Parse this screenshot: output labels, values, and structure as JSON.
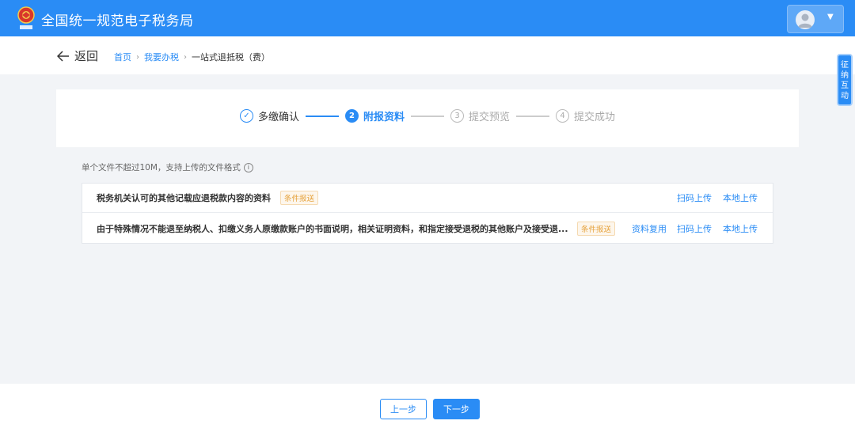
{
  "header": {
    "site_title": "全国统一规范电子税务局",
    "logo_caption": "中国税务"
  },
  "breadcrumb": {
    "back_label": "返回",
    "items": [
      "首页",
      "我要办税",
      "一站式退抵税（费）"
    ],
    "separator": "›"
  },
  "float_tab": {
    "label": "征纳互动"
  },
  "steps": [
    {
      "number": "✓",
      "label": "多缴确认",
      "state": "done"
    },
    {
      "number": "2",
      "label": "附报资料",
      "state": "active"
    },
    {
      "number": "3",
      "label": "提交预览",
      "state": "todo"
    },
    {
      "number": "4",
      "label": "提交成功",
      "state": "todo"
    }
  ],
  "file_note": "单个文件不超过10M，支持上传的文件格式",
  "documents": [
    {
      "title": "税务机关认可的其他记载应退税款内容的资料",
      "tag": "条件报送",
      "actions": [
        "扫码上传",
        "本地上传"
      ]
    },
    {
      "title": "由于特殊情况不能退至纳税人、扣缴义务人原缴款账户的书面说明，相关证明资料，和指定接受退税的其他账户及接受退...",
      "tag": "条件报送",
      "actions": [
        "资料复用",
        "扫码上传",
        "本地上传"
      ]
    }
  ],
  "footer": {
    "prev_label": "上一步",
    "next_label": "下一步"
  },
  "colors": {
    "primary": "#2a8cf5",
    "tag_text": "#e6a23c",
    "tag_bg": "#fdf6ec"
  }
}
